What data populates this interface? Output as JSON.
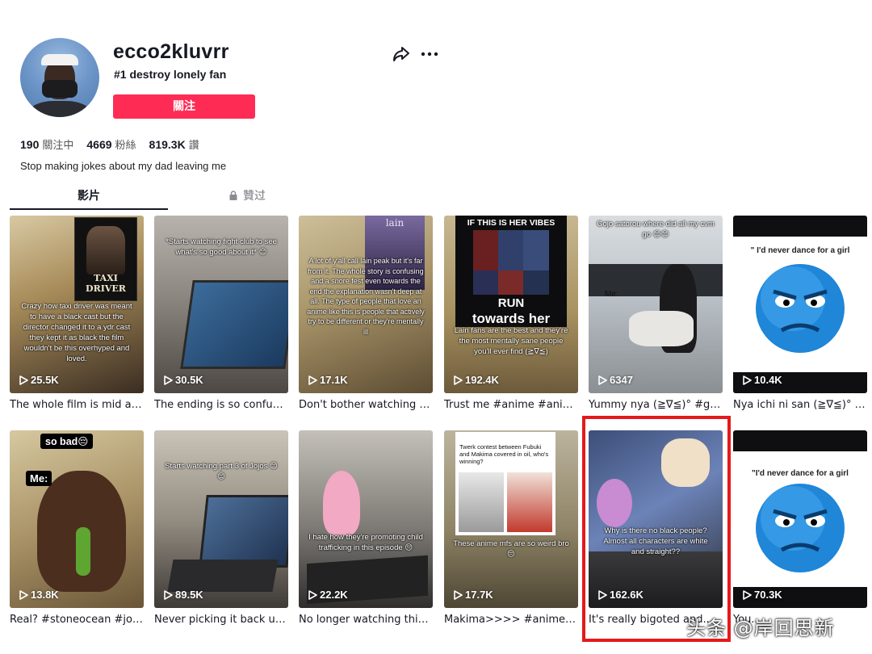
{
  "profile": {
    "username": "ecco2kluvrr",
    "nickname": "#1 destroy lonely fan",
    "follow_label": "關注",
    "bio": "Stop making jokes about my dad leaving me",
    "stats": [
      {
        "value": "190",
        "label": "關注中"
      },
      {
        "value": "4669",
        "label": "粉絲"
      },
      {
        "value": "819.3K",
        "label": "讚"
      }
    ]
  },
  "tabs": {
    "videos": "影片",
    "liked": "贊过"
  },
  "accent_color": "#fe2c55",
  "highlight_color": "#e5191b",
  "videos": [
    {
      "views": "25.5K",
      "caption": "The whole film is mid an...",
      "overlay": "Crazy how taxi driver was meant to have a black cast but the director changed it to a ydr cast they kept it as black the film wouldn't be this overhyped and loved.",
      "poster": "TAXI DRIVER"
    },
    {
      "views": "30.5K",
      "caption": "The ending is so confusi...",
      "overlay": "*Starts watching fight club to see what's so good about it* 😊"
    },
    {
      "views": "17.1K",
      "caption": "Don't bother watching w...",
      "overlay": "A lot of y'all call lain peak but it's far from it. The whole story is confusing and a snore fest even towards the end the explanation wasn't deep at all. The type of people that love an anime like this is people that actively try to be different or they're mentally ill",
      "poster": "lain"
    },
    {
      "views": "192.4K",
      "caption": "Trust me #anime #anim...",
      "overlay": "Lain fans are the best and they're the most mentally sane people you'll ever find (≧∇≦)",
      "top_text": "IF THIS IS HER VIBES",
      "big_text_1": "RUN",
      "big_text_2": "towards her"
    },
    {
      "views": "6347",
      "caption": "Yummy nya (≧∇≦)° #goj...",
      "overlay": "Gojo satorou where did all my cvm go 😊😊",
      "label_me": "Me:"
    },
    {
      "views": "10.4K",
      "caption": "Nya ichi ni san (≧∇≦)° #...",
      "overlay": "\" I'd never dance for a girl"
    },
    {
      "views": "13.8K",
      "caption": "Real? #stoneocean #joly...",
      "top_text": "so bad😔",
      "label_me": "Me:"
    },
    {
      "views": "89.5K",
      "caption": "Never picking it back up ...",
      "overlay": "Starts watching part 3 of Jojos 😊😊"
    },
    {
      "views": "22.2K",
      "caption": "No longer watching this ...",
      "overlay": "I hate how they're promoting child trafficking in this episode 😔"
    },
    {
      "views": "17.7K",
      "caption": "Makima>>>> #anime #a...",
      "overlay": "These anime mfs are so weird bro 😔",
      "tweet": "Twerk contest between Fubuki and Makima covered in oil, who's winning?"
    },
    {
      "views": "162.6K",
      "caption": "It's really bigoted and...",
      "overlay": "Why is there no black people? Almost all characters are white and straight??"
    },
    {
      "views": "70.3K",
      "caption": "You...",
      "overlay": "\"I'd never dance for a girl"
    }
  ],
  "watermark": "头条 @岸回思新"
}
